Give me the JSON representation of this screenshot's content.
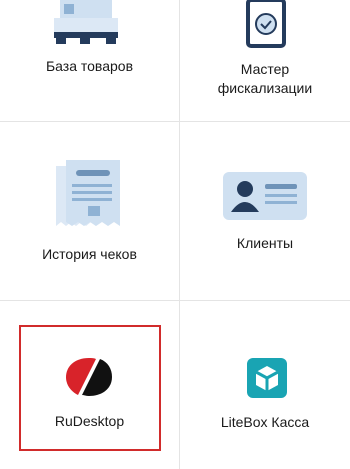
{
  "tiles": [
    {
      "label": "База товаров",
      "icon": "products-base-icon"
    },
    {
      "label": "Мастер фискализации",
      "label_lines": [
        "Мастер",
        "фискализации"
      ],
      "icon": "fiscal-wizard-icon"
    },
    {
      "label": "История чеков",
      "icon": "receipt-history-icon"
    },
    {
      "label": "Клиенты",
      "icon": "client-card-icon"
    },
    {
      "label": "RuDesktop",
      "icon": "rudesktop-logo-icon",
      "selected": true
    },
    {
      "label": "LiteBox Касса",
      "icon": "litebox-logo-icon"
    }
  ],
  "colors": {
    "icon_dark": "#243b5c",
    "icon_light": "#cfe0f1",
    "icon_mid": "#8fb2d4",
    "accent_teal": "#19a4b3",
    "rudesktop_red": "#d8232a",
    "selection_border": "#d12b2b",
    "divider": "#e4e4e4"
  }
}
